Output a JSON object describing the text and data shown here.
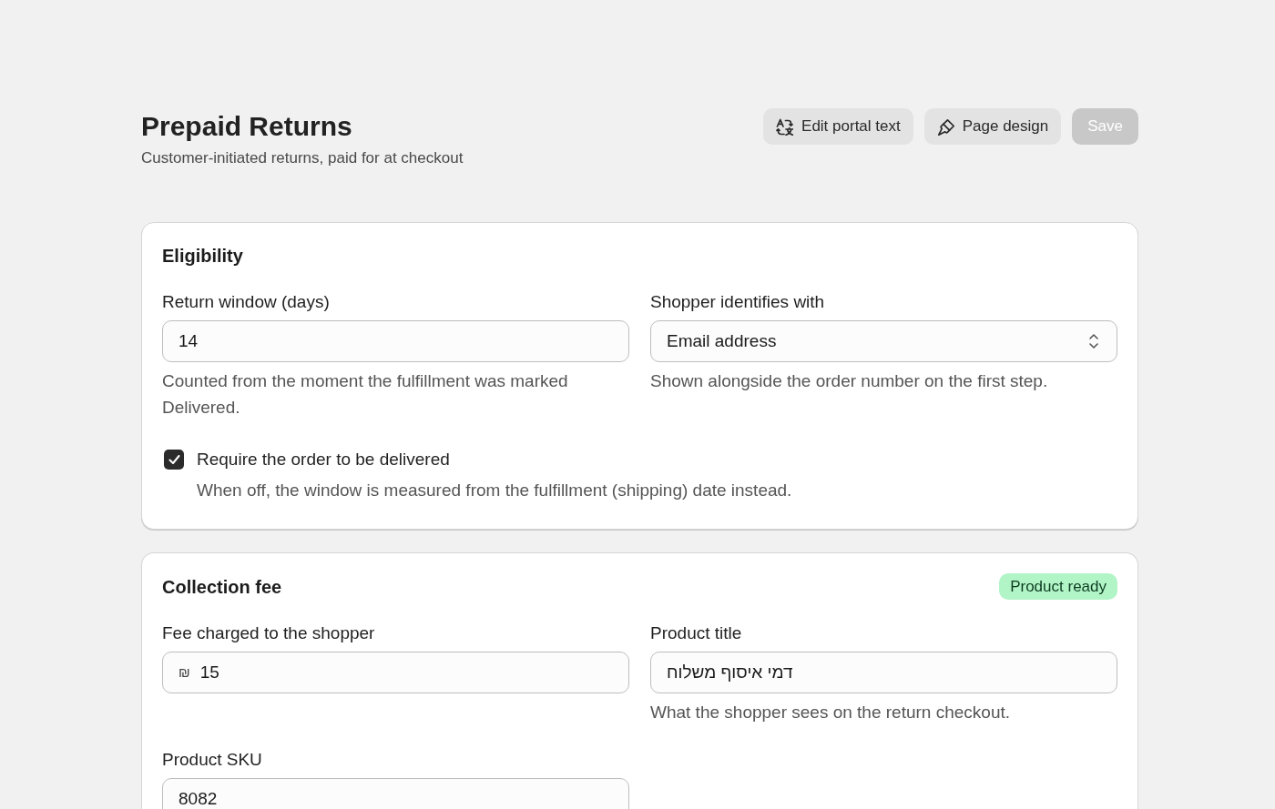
{
  "page": {
    "title": "Prepaid Returns",
    "subtitle": "Customer-initiated returns, paid for at checkout"
  },
  "actions": [
    {
      "label": "Edit portal text",
      "disabled": false
    },
    {
      "label": "Page design",
      "disabled": false
    },
    {
      "label": "Save",
      "disabled": true
    }
  ],
  "sections": [
    {
      "title": "Eligibility",
      "fields": [
        {
          "kind": "input",
          "label": "Return window (days)",
          "value": "14",
          "help": "Counted from the moment the fulfillment was marked Delivered."
        },
        {
          "kind": "select",
          "label": "Shopper identifies with",
          "value": "Email address",
          "help": "Shown alongside the order number on the first step."
        }
      ],
      "checkbox": {
        "label": "Require the order to be delivered",
        "description": "When off, the window is measured from the fulfillment (shipping) date instead.",
        "checked": true
      }
    },
    {
      "title": "Collection fee",
      "badge": "Product ready",
      "fields": [
        {
          "kind": "input",
          "label": "Fee charged to the shopper",
          "prefix": "₪",
          "value": "15"
        },
        {
          "kind": "input",
          "label": "Product title",
          "value": "דמי איסוף משלוח",
          "help": "What the shopper sees on the return checkout."
        },
        {
          "kind": "input",
          "label": "Product SKU",
          "value": "8082"
        }
      ]
    }
  ]
}
